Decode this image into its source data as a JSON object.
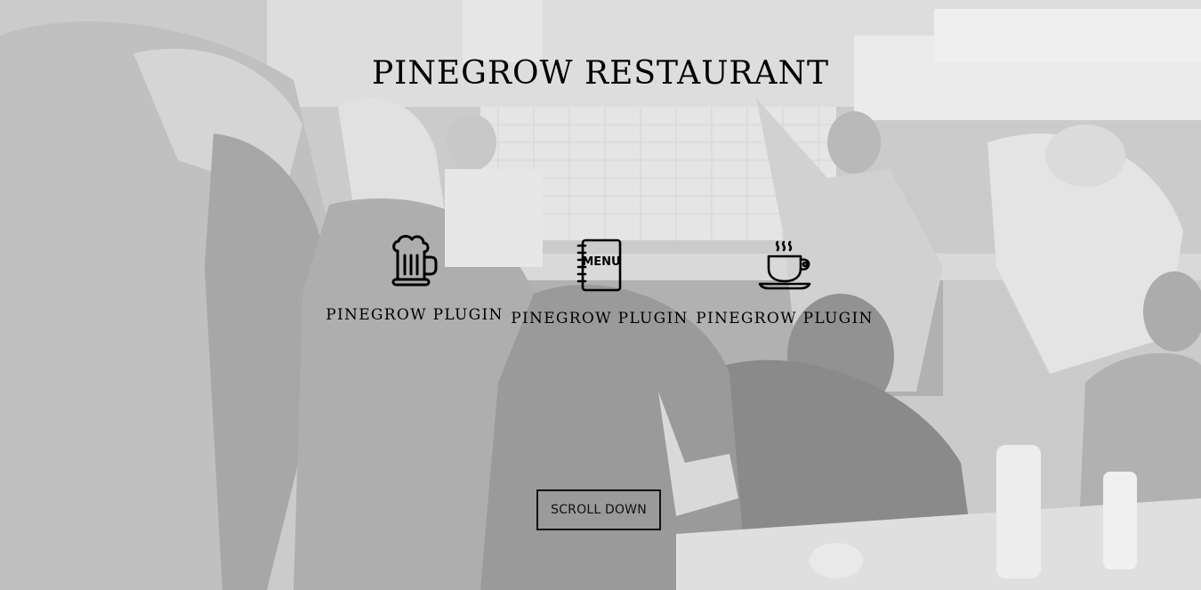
{
  "hero": {
    "title": "PINEGROW RESTAURANT",
    "background": "restaurant-kitchen-photo",
    "features": [
      {
        "icon": "beer-mug-icon",
        "label": "PINEGROW PLUGIN"
      },
      {
        "icon": "menu-book-icon",
        "icon_text": "MENU",
        "label": "PINEGROW PLUGIN"
      },
      {
        "icon": "coffee-cup-icon",
        "label": "PINEGROW PLUGIN"
      }
    ],
    "scroll_button": "SCROLL DOWN"
  },
  "colors": {
    "text": "#000000",
    "overlay": "#ebebeb"
  }
}
